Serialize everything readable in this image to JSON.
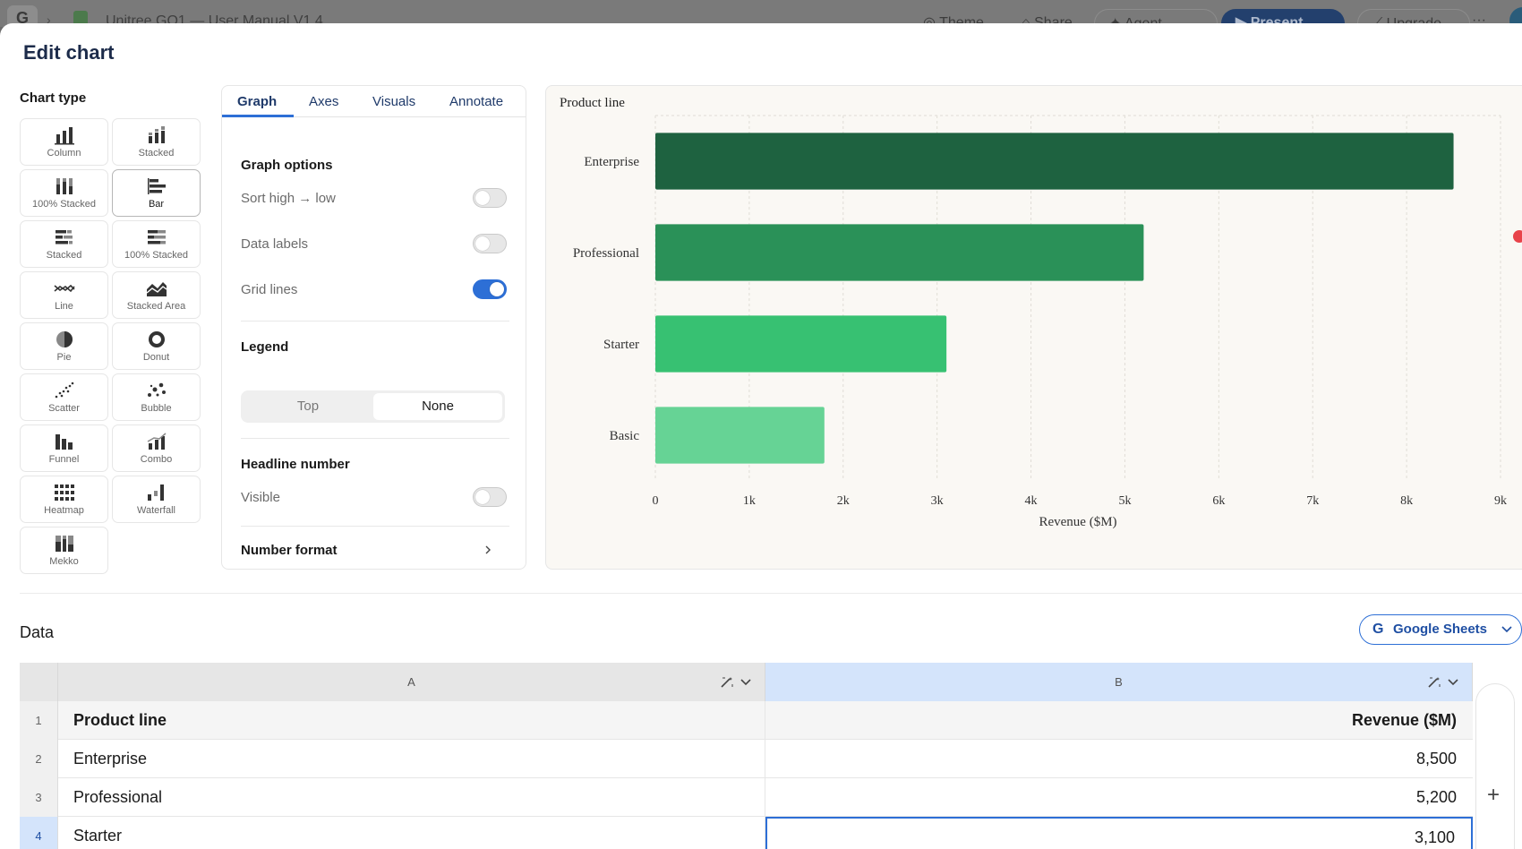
{
  "appbar": {
    "logo": "G",
    "doc_title": "Unitree GO1 — User Manual V1.4",
    "theme": "Theme",
    "share": "Share",
    "agent": "Agent",
    "present": "Present",
    "upgrade": "Upgrade",
    "more": "···"
  },
  "modal": {
    "title": "Edit chart"
  },
  "chart_types": {
    "label": "Chart type",
    "items": [
      {
        "label": "Column",
        "icon": "column-chart-icon"
      },
      {
        "label": "Stacked",
        "icon": "stacked-column-icon"
      },
      {
        "label": "100% Stacked",
        "icon": "percent-stacked-column-icon"
      },
      {
        "label": "Bar",
        "icon": "bar-chart-icon",
        "selected": true
      },
      {
        "label": "Stacked",
        "icon": "stacked-bar-icon"
      },
      {
        "label": "100% Stacked",
        "icon": "percent-stacked-bar-icon"
      },
      {
        "label": "Line",
        "icon": "line-chart-icon"
      },
      {
        "label": "Stacked Area",
        "icon": "stacked-area-icon"
      },
      {
        "label": "Pie",
        "icon": "pie-chart-icon"
      },
      {
        "label": "Donut",
        "icon": "donut-chart-icon"
      },
      {
        "label": "Scatter",
        "icon": "scatter-chart-icon"
      },
      {
        "label": "Bubble",
        "icon": "bubble-chart-icon"
      },
      {
        "label": "Funnel",
        "icon": "funnel-chart-icon"
      },
      {
        "label": "Combo",
        "icon": "combo-chart-icon"
      },
      {
        "label": "Heatmap",
        "icon": "heatmap-icon"
      },
      {
        "label": "Waterfall",
        "icon": "waterfall-chart-icon"
      },
      {
        "label": "Mekko",
        "icon": "mekko-chart-icon"
      }
    ]
  },
  "options": {
    "tabs": [
      "Graph",
      "Axes",
      "Visuals",
      "Annotate"
    ],
    "active_tab": "Graph",
    "graph_options_title": "Graph options",
    "sort_label": "Sort high → low",
    "sort_on": false,
    "data_labels_label": "Data labels",
    "data_labels_on": false,
    "grid_lines_label": "Grid lines",
    "grid_lines_on": true,
    "legend_title": "Legend",
    "legend_options": [
      "Top",
      "None"
    ],
    "legend_selected": "None",
    "headline_title": "Headline number",
    "visible_label": "Visible",
    "visible_on": false,
    "number_format_label": "Number format"
  },
  "chart_data": {
    "type": "bar",
    "orientation": "horizontal",
    "title": "Product line",
    "categories": [
      "Enterprise",
      "Professional",
      "Starter",
      "Basic"
    ],
    "values": [
      8500,
      5200,
      3100,
      1800
    ],
    "xlabel": "Revenue ($M)",
    "ylabel": "",
    "xlim": [
      0,
      9000
    ],
    "xticks": [
      "0",
      "1k",
      "2k",
      "3k",
      "4k",
      "5k",
      "6k",
      "7k",
      "8k",
      "9k"
    ],
    "grid": true,
    "legend": "none",
    "colors": [
      "#1e6240",
      "#2a9158",
      "#37c172",
      "#66d395"
    ],
    "background": "#faf8f4"
  },
  "data_section": {
    "title": "Data",
    "source_button": "Google Sheets",
    "columns": [
      "A",
      "B"
    ],
    "rows": [
      {
        "n": "1",
        "a": "Product line",
        "b": "Revenue ($M)"
      },
      {
        "n": "2",
        "a": "Enterprise",
        "b": "8,500"
      },
      {
        "n": "3",
        "a": "Professional",
        "b": "5,200"
      },
      {
        "n": "4",
        "a": "Starter",
        "b": "3,100"
      }
    ],
    "add_column": "+"
  }
}
